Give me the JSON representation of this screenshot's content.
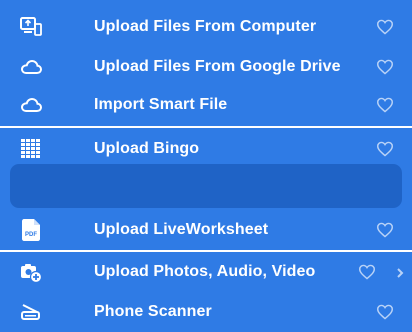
{
  "menu": {
    "items": [
      {
        "label": "Upload Files From Computer",
        "icon": "computer-upload-icon",
        "favorite": false
      },
      {
        "label": "Upload Files From Google Drive",
        "icon": "cloud-icon",
        "favorite": false
      },
      {
        "label": "Import Smart File",
        "icon": "cloud-icon",
        "favorite": false
      },
      {
        "label": "Upload Bingo",
        "icon": "bingo-grid-icon",
        "favorite": false
      },
      {
        "label": "Upload LiveWorksheet",
        "icon": "pdf-file-icon",
        "favorite": false
      },
      {
        "label": "Upload Photos, Audio, Video",
        "icon": "media-upload-icon",
        "favorite": false,
        "has_submenu": true
      },
      {
        "label": "Phone Scanner",
        "icon": "scanner-icon",
        "favorite": false
      }
    ]
  },
  "colors": {
    "background": "#2f7be5",
    "highlight_box": "#1f63c6",
    "heart_outline": "#b8d2f7",
    "text": "#ffffff"
  }
}
